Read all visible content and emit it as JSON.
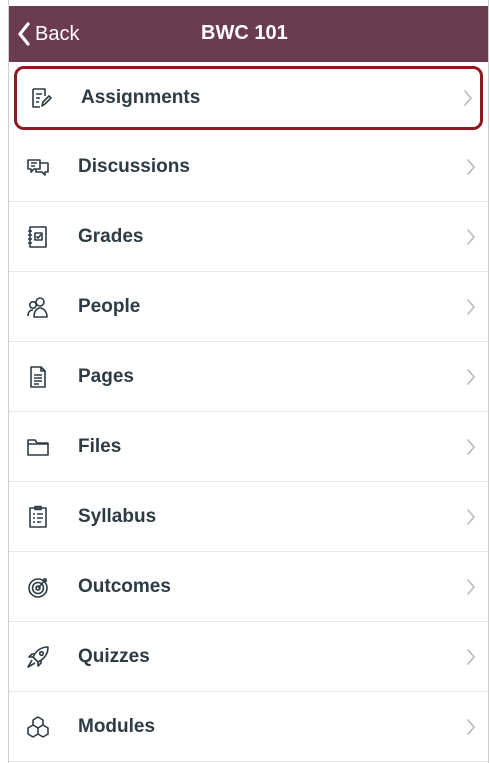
{
  "nav": {
    "back_label": "Back",
    "title": "BWC 101",
    "bar_color": "#6b3b50"
  },
  "menu": {
    "items": [
      {
        "label": "Assignments",
        "icon": "assignments-icon",
        "highlighted": true
      },
      {
        "label": "Discussions",
        "icon": "discussions-icon"
      },
      {
        "label": "Grades",
        "icon": "grades-icon"
      },
      {
        "label": "People",
        "icon": "people-icon"
      },
      {
        "label": "Pages",
        "icon": "pages-icon"
      },
      {
        "label": "Files",
        "icon": "files-icon"
      },
      {
        "label": "Syllabus",
        "icon": "syllabus-icon"
      },
      {
        "label": "Outcomes",
        "icon": "outcomes-icon"
      },
      {
        "label": "Quizzes",
        "icon": "quizzes-icon"
      },
      {
        "label": "Modules",
        "icon": "modules-icon"
      }
    ],
    "highlight_color": "#8d1a21"
  }
}
